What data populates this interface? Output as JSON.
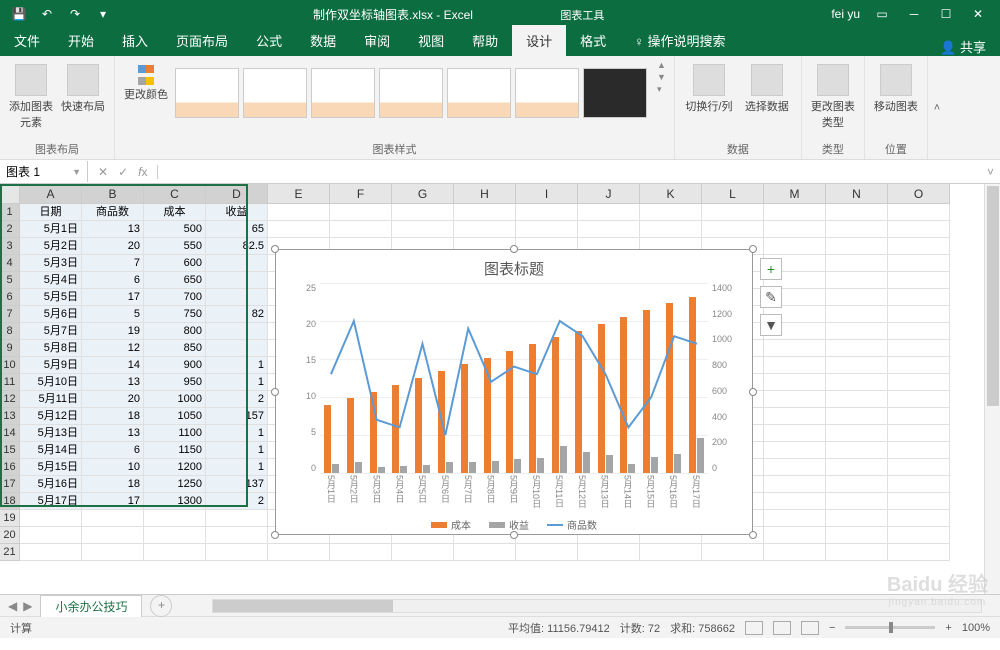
{
  "titlebar": {
    "doc_title": "制作双坐标轴图表.xlsx - Excel",
    "chart_tools": "图表工具",
    "user": "fei yu"
  },
  "tabs": [
    "文件",
    "开始",
    "插入",
    "页面布局",
    "公式",
    "数据",
    "审阅",
    "视图",
    "帮助",
    "设计",
    "格式"
  ],
  "help_search": "操作说明搜索",
  "share": "共享",
  "ribbon": {
    "layout_group": "图表布局",
    "styles_group": "图表样式",
    "data_group": "数据",
    "type_group": "类型",
    "location_group": "位置",
    "add_element": "添加图表元素",
    "quick_layout": "快速布局",
    "change_colors": "更改颜色",
    "switch_rowcol": "切换行/列",
    "select_data": "选择数据",
    "change_type": "更改图表类型",
    "move_chart": "移动图表"
  },
  "namebox": "图表 1",
  "columns": [
    "A",
    "B",
    "C",
    "D",
    "E",
    "F",
    "G",
    "H",
    "I",
    "J",
    "K",
    "L",
    "M",
    "N",
    "O"
  ],
  "table": {
    "headers": [
      "日期",
      "商品数",
      "成本",
      "收益"
    ],
    "rows": [
      [
        "5月1日",
        "13",
        "500",
        "65"
      ],
      [
        "5月2日",
        "20",
        "550",
        "82.5"
      ],
      [
        "5月3日",
        "7",
        "600",
        ""
      ],
      [
        "5月4日",
        "6",
        "650",
        ""
      ],
      [
        "5月5日",
        "17",
        "700",
        ""
      ],
      [
        "5月6日",
        "5",
        "750",
        "82"
      ],
      [
        "5月7日",
        "19",
        "800",
        ""
      ],
      [
        "5月8日",
        "12",
        "850",
        ""
      ],
      [
        "5月9日",
        "14",
        "900",
        "1"
      ],
      [
        "5月10日",
        "13",
        "950",
        "1"
      ],
      [
        "5月11日",
        "20",
        "1000",
        "2"
      ],
      [
        "5月12日",
        "18",
        "1050",
        "157"
      ],
      [
        "5月13日",
        "13",
        "1100",
        "1"
      ],
      [
        "5月14日",
        "6",
        "1150",
        "1"
      ],
      [
        "5月15日",
        "10",
        "1200",
        "1"
      ],
      [
        "5月16日",
        "18",
        "1250",
        "137"
      ],
      [
        "5月17日",
        "17",
        "1300",
        "2"
      ]
    ]
  },
  "chart_data": {
    "type": "bar",
    "title": "图表标题",
    "categories": [
      "5月1日",
      "5月2日",
      "5月3日",
      "5月4日",
      "5月5日",
      "5月6日",
      "5月7日",
      "5月8日",
      "5月9日",
      "5月10日",
      "5月11日",
      "5月12日",
      "5月13日",
      "5月14日",
      "5月15日",
      "5月16日",
      "5月17日"
    ],
    "series": [
      {
        "name": "成本",
        "axis": "right",
        "type": "bar",
        "color": "#ed7d31",
        "values": [
          500,
          550,
          600,
          650,
          700,
          750,
          800,
          850,
          900,
          950,
          1000,
          1050,
          1100,
          1150,
          1200,
          1250,
          1300
        ]
      },
      {
        "name": "收益",
        "axis": "right",
        "type": "bar",
        "color": "#a5a5a5",
        "values": [
          65,
          82.5,
          42,
          52,
          60,
          82,
          80,
          90,
          100,
          110,
          200,
          157,
          130,
          70,
          120,
          137,
          260
        ]
      },
      {
        "name": "商品数",
        "axis": "left",
        "type": "line",
        "color": "#5b9bd5",
        "values": [
          13,
          20,
          7,
          6,
          17,
          5,
          19,
          12,
          14,
          13,
          20,
          18,
          13,
          6,
          10,
          18,
          17
        ]
      }
    ],
    "y_left": {
      "min": 0,
      "max": 25,
      "ticks": [
        0,
        5,
        10,
        15,
        20,
        25
      ]
    },
    "y_right": {
      "min": 0,
      "max": 1400,
      "ticks": [
        0,
        200,
        400,
        600,
        800,
        1000,
        1200,
        1400
      ]
    }
  },
  "sheet_tab": "小余办公技巧",
  "statusbar": {
    "mode": "计算",
    "avg_label": "平均值:",
    "avg": "11156.79412",
    "count_label": "计数:",
    "count": "72",
    "sum_label": "求和:",
    "sum": "758662",
    "zoom": "100%"
  },
  "watermark": {
    "brand": "Baidu 经验",
    "url": "jingyan.baidu.com"
  }
}
